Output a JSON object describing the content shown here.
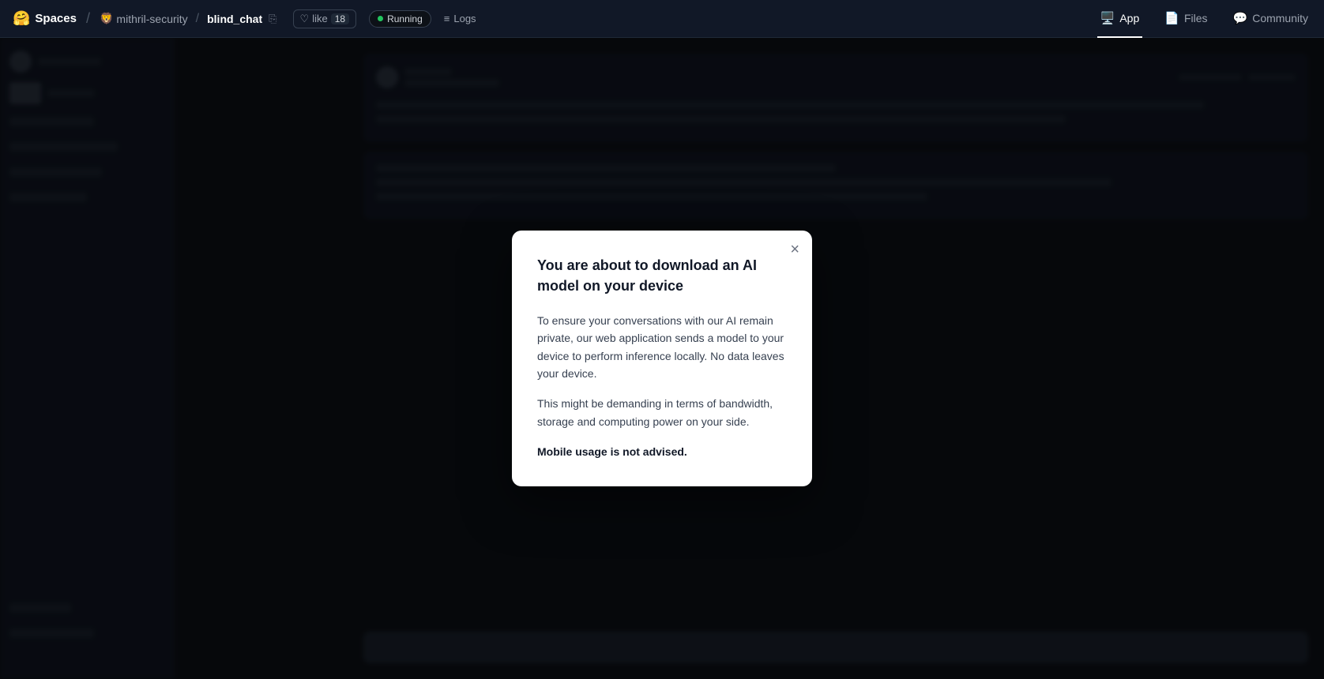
{
  "nav": {
    "spaces_label": "Spaces",
    "spaces_emoji": "🤗",
    "org": "mithril-security",
    "repo": "blind_chat",
    "like_label": "like",
    "like_count": "18",
    "running_label": "Running",
    "logs_label": "Logs",
    "tabs": [
      {
        "id": "app",
        "label": "App",
        "icon": "🖥️",
        "active": true
      },
      {
        "id": "files",
        "label": "Files",
        "icon": "📄",
        "active": false
      },
      {
        "id": "community",
        "label": "Community",
        "icon": "💬",
        "active": false
      }
    ]
  },
  "modal": {
    "title": "You are about to download an AI model on your device",
    "body_paragraph1": "To ensure your conversations with our AI remain private, our web application sends a model to your device to perform inference locally. No data leaves your device.",
    "body_paragraph2": "This might be demanding in terms of bandwidth, storage and computing power on your side.",
    "body_bold": "Mobile usage is not advised.",
    "close_label": "×"
  }
}
